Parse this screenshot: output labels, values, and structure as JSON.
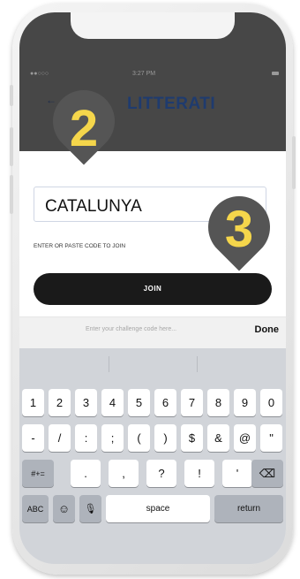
{
  "status": {
    "signal": "●●○○○",
    "time": "3:27 PM"
  },
  "header": {
    "back_label": "←",
    "title": "LITTERATI"
  },
  "join": {
    "code_value": "CATALUNYA",
    "help_text": "ENTER OR PASTE CODE TO JOIN",
    "button_label": "JOIN"
  },
  "accessory": {
    "placeholder": "Enter your challenge code here...",
    "done_label": "Done"
  },
  "keyboard": {
    "row1": [
      "1",
      "2",
      "3",
      "4",
      "5",
      "6",
      "7",
      "8",
      "9",
      "0"
    ],
    "row2": [
      "-",
      "/",
      ":",
      ";",
      "(",
      ")",
      "$",
      "&",
      "@",
      "\""
    ],
    "row3": [
      "#+=",
      ".",
      ",",
      "?",
      "!",
      "'",
      "⌫"
    ],
    "row4": [
      "ABC",
      "☺",
      "🎙",
      "space",
      "return"
    ]
  },
  "annotations": {
    "marker_2": "2",
    "marker_3": "3",
    "marker_color": "#f5d64b"
  },
  "colors": {
    "header_bg": "#474747",
    "title": "#1f3b6e",
    "join_button": "#1a1a1a"
  }
}
